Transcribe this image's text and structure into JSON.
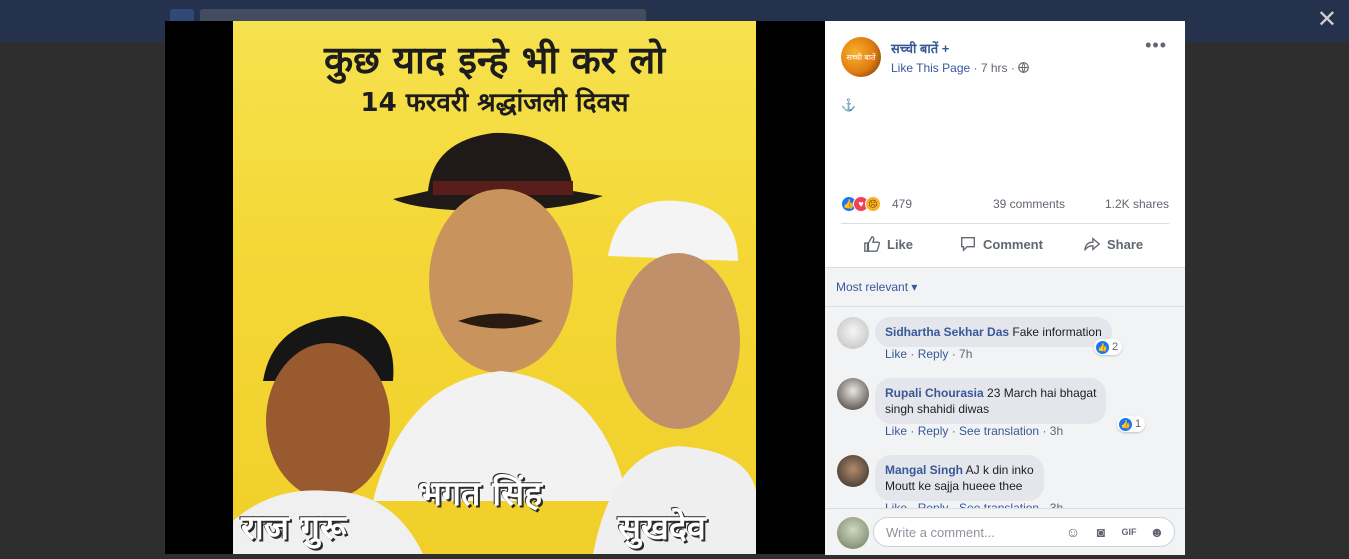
{
  "post": {
    "page_name": "सच्ची बातें",
    "verified_mark": "+",
    "avatar_text": "सच्ची बातें",
    "like_page": "Like This Page",
    "time": "7 hrs",
    "separator": "·",
    "body_text": "⚓",
    "reaction_count": "479",
    "comments_count": "39 comments",
    "shares_count": "1.2K shares",
    "actions": {
      "like": "Like",
      "comment": "Comment",
      "share": "Share"
    }
  },
  "photo": {
    "headline": "कुछ याद इन्हे भी कर लो",
    "subheadline": "14 फरवरी श्रद्धांजली दिवस",
    "caption_center": "भगत सिंह",
    "caption_left": "राज गुरू",
    "caption_right": "सुखदेव"
  },
  "comments": {
    "sort_label": "Most relevant",
    "items": [
      {
        "name": "Sidhartha Sekhar Das",
        "text": "Fake information",
        "like": "Like",
        "reply": "Reply",
        "translation": "",
        "time": "7h",
        "reactions": "2"
      },
      {
        "name": "Rupali Chourasia",
        "text": "23 March hai bhagat",
        "text2": "singh shahidi diwas",
        "like": "Like",
        "reply": "Reply",
        "translation": "See translation",
        "time": "3h",
        "reactions": "1"
      },
      {
        "name": "Mangal Singh",
        "text": "AJ k din inko",
        "text2": "Moutt ke sajja hueee thee",
        "like": "Like",
        "reply": "Reply",
        "translation": "See translation",
        "time": "3h",
        "reactions": ""
      }
    ]
  },
  "composer": {
    "placeholder": "Write a comment..."
  },
  "viewer": {
    "close_symbol": "✕"
  },
  "colors": {
    "link": "#385898",
    "accent": "#1877f2",
    "topbar": "#25324d"
  }
}
